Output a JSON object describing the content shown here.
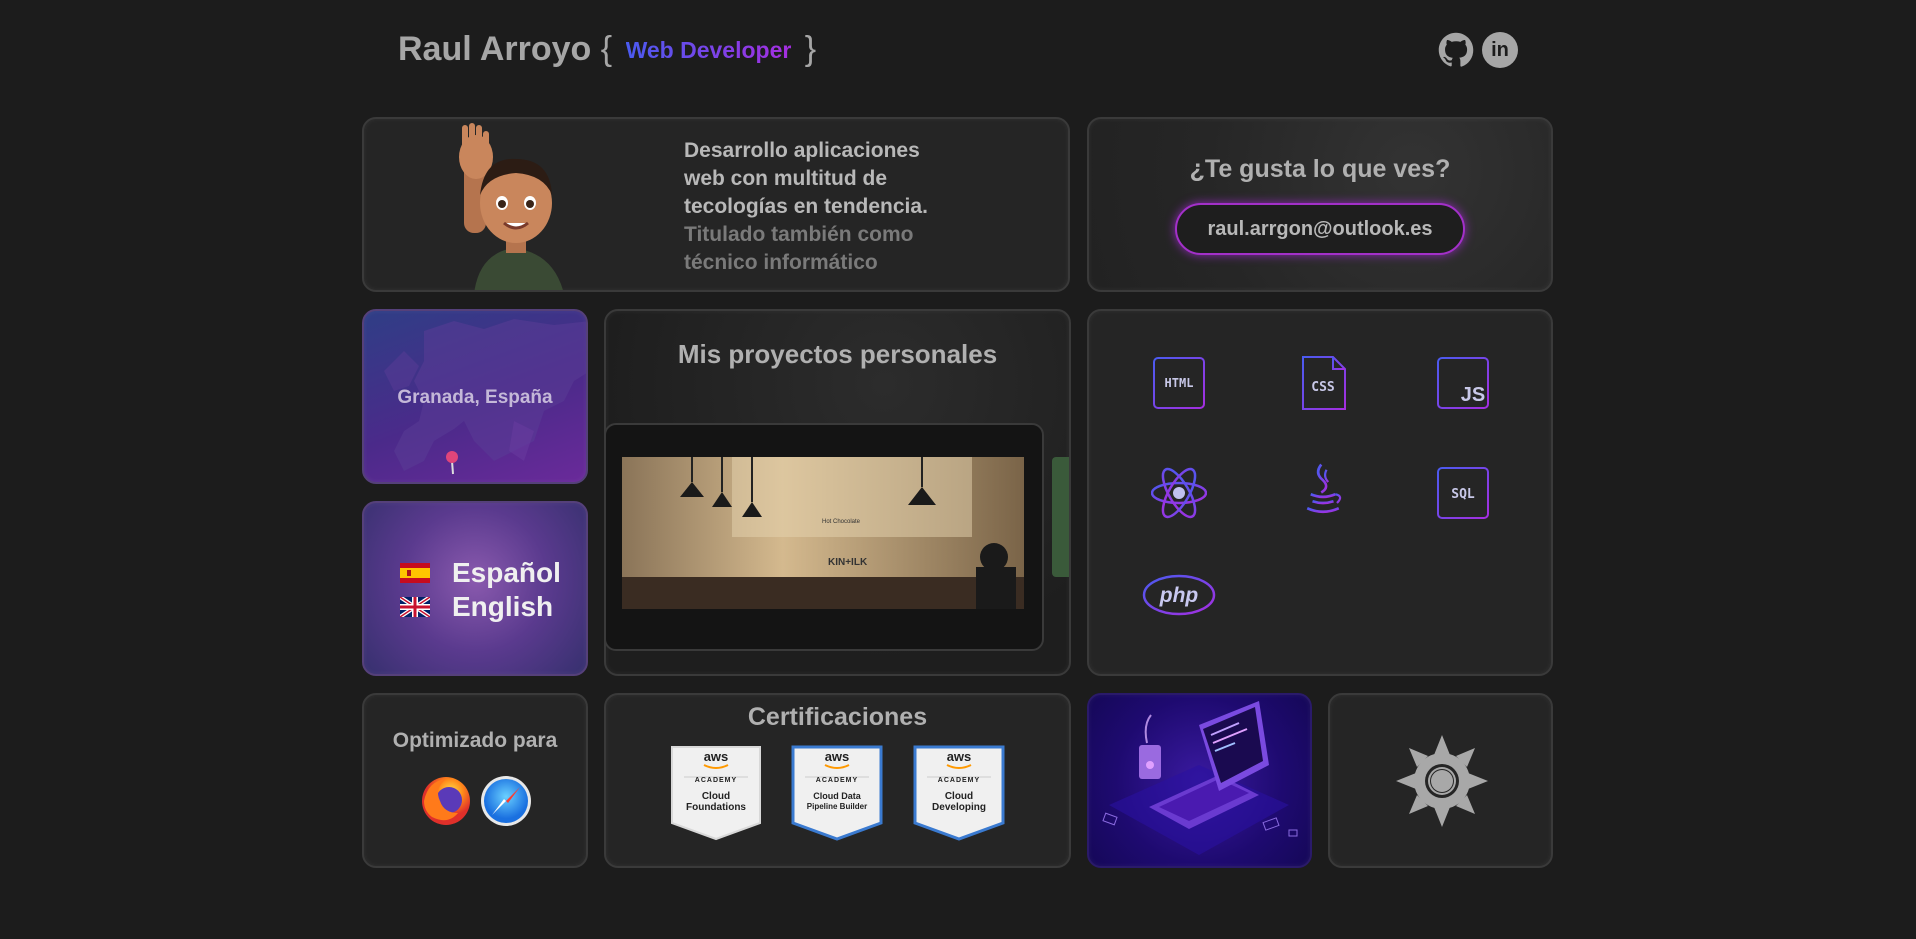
{
  "header": {
    "name": "Raul Arroyo",
    "brace_open": "{",
    "role": "Web Developer",
    "brace_close": "}",
    "github_icon": "github-icon",
    "linkedin_icon": "linkedin-icon",
    "linkedin_text": "in"
  },
  "about": {
    "line1": "Desarrollo aplicaciones",
    "line2": "web con multitud de",
    "line3": "tecologías en tendencia.",
    "line4": "Titulado también como",
    "line5": "técnico informático"
  },
  "contact": {
    "question": "¿Te gusta lo que ves?",
    "email": "raul.arrgon@outlook.es"
  },
  "location": {
    "label": "Granada, España"
  },
  "languages": [
    {
      "label": "Español",
      "flag": "spain-flag"
    },
    {
      "label": "English",
      "flag": "uk-flag"
    }
  ],
  "projects": {
    "title": "Mis proyectos personales",
    "sign_text": "KIN+ILK",
    "menu_text": "Hot Chocolate"
  },
  "tech": [
    {
      "name": "html-icon",
      "label": "HTML"
    },
    {
      "name": "css-icon",
      "label": "CSS"
    },
    {
      "name": "js-icon",
      "label": "JS"
    },
    {
      "name": "react-icon",
      "label": ""
    },
    {
      "name": "java-icon",
      "label": ""
    },
    {
      "name": "sql-icon",
      "label": "SQL"
    },
    {
      "name": "php-icon",
      "label": "php"
    }
  ],
  "optimized": {
    "title": "Optimizado para",
    "browsers": [
      "firefox-icon",
      "safari-icon"
    ]
  },
  "certifications": {
    "title": "Certificaciones",
    "badges": [
      {
        "brand": "aws",
        "org": "ACADEMY",
        "line1": "Cloud",
        "line2": "Foundations"
      },
      {
        "brand": "aws",
        "org": "ACADEMY",
        "line1": "Cloud Data",
        "line2": "Pipeline Builder"
      },
      {
        "brand": "aws",
        "org": "ACADEMY",
        "line1": "Cloud",
        "line2": "Developing"
      }
    ]
  },
  "theme": {
    "icon": "sun-icon"
  },
  "colors": {
    "background": "#1c1c1c",
    "card": "#252525",
    "accent_blue": "#4a5bf0",
    "accent_purple": "#a52ee0"
  }
}
